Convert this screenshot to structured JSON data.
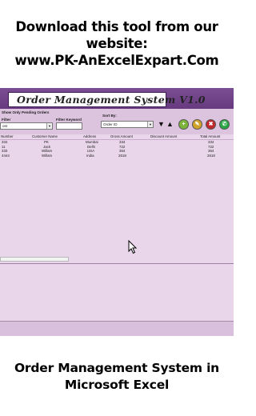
{
  "banner": {
    "line1": "Download this tool from our",
    "line2": "website:",
    "line3": "www.PK-AnExcelExpart.Com"
  },
  "app": {
    "title": "Order Management System V1.0",
    "show_pending": "Show Only Pending Orders",
    "filter_label": "Filter",
    "filter_value": "ost",
    "filter_keyword_label": "Filter Keyword",
    "sort_by_label": "Sort By:",
    "sort_value": "Order ID",
    "columns": [
      "Number",
      "Customer Name",
      "Address",
      "Gross Amount",
      "Discount Amount",
      "Total Amount"
    ],
    "rows": [
      [
        "334",
        "PK",
        "Mumbai",
        "334",
        "",
        "334"
      ],
      [
        "11",
        "Jack",
        "Delhi",
        "722",
        "",
        "722"
      ],
      [
        "333",
        "Willam",
        "USA",
        "364",
        "",
        "364"
      ],
      [
        "4444",
        "Willam",
        "India",
        "2618",
        "",
        "2618"
      ]
    ],
    "icons": {
      "sort_desc": "triangle-down-icon",
      "sort_asc": "triangle-up-icon",
      "add": "plus-icon",
      "edit": "edit-icon",
      "delete": "delete-icon",
      "whatsapp": "whatsapp-icon"
    },
    "colors": {
      "title_bar": "#7b4d93",
      "background": "#e9d6ea",
      "add": "#7cb33b",
      "edit": "#cfa22a",
      "delete": "#c0282d",
      "whatsapp": "#29a745"
    }
  },
  "footer": {
    "line1": "Order Management System in",
    "line2": "Microsoft Excel"
  }
}
